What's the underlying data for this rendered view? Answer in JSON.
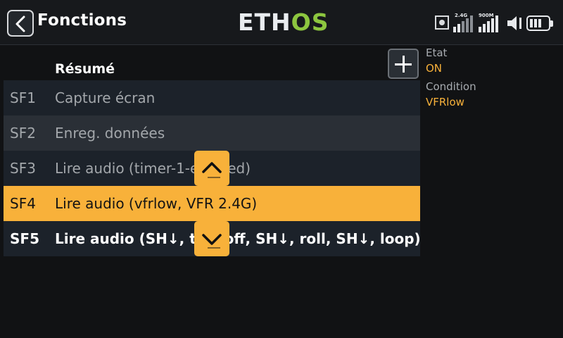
{
  "header": {
    "title": "Fonctions",
    "logo_part1": "ETH",
    "logo_part2": "OS",
    "signal1_label": "2.4G",
    "signal2_label": "900M"
  },
  "list": {
    "header": "Résumé",
    "rows": [
      {
        "code": "SF1",
        "desc": "Capture écran"
      },
      {
        "code": "SF2",
        "desc": "Enreg. données"
      },
      {
        "code": "SF3",
        "desc": "Lire audio (timer-1-elapsed)"
      },
      {
        "code": "SF4",
        "desc": "Lire audio (vfrlow, VFR 2.4G)"
      },
      {
        "code": "SF5",
        "desc": "Lire audio (SH↓, takeoff, SH↓, roll, SH↓, loop)"
      }
    ],
    "selected_index": 3
  },
  "properties": {
    "etat_label": "Etat",
    "etat_value": "ON",
    "condition_label": "Condition",
    "condition_value": "VFRlow"
  },
  "colors": {
    "accent": "#f8b13a",
    "logo_green": "#8dc63f",
    "row_dark": "#1c222a",
    "row_alt": "#2a2f36"
  },
  "icons": [
    "back-arrow-icon",
    "add-icon",
    "chevron-up-icon",
    "chevron-down-icon",
    "record-icon",
    "signal-icon",
    "speaker-icon",
    "battery-icon"
  ]
}
